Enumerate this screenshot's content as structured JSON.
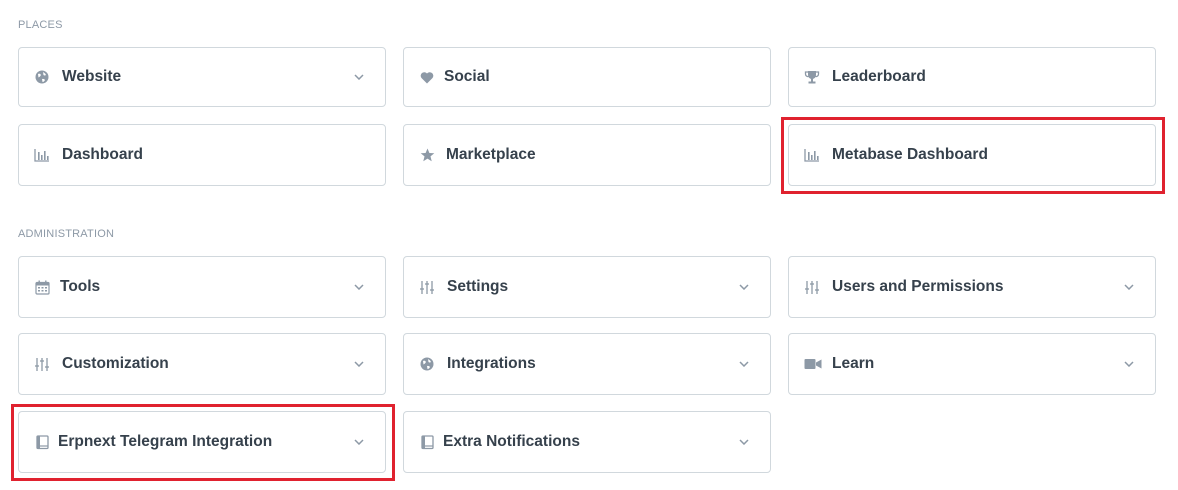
{
  "places": {
    "heading": "PLACES",
    "cards": [
      {
        "label": "Website",
        "icon": "globe-icon",
        "has_dropdown": true
      },
      {
        "label": "Social",
        "icon": "heart-icon",
        "has_dropdown": false
      },
      {
        "label": "Leaderboard",
        "icon": "trophy-icon",
        "has_dropdown": false
      },
      {
        "label": "Dashboard",
        "icon": "bar-chart-icon",
        "has_dropdown": false
      },
      {
        "label": "Marketplace",
        "icon": "star-icon",
        "has_dropdown": false
      },
      {
        "label": "Metabase Dashboard",
        "icon": "bar-chart-icon",
        "has_dropdown": false,
        "highlighted": true
      }
    ]
  },
  "administration": {
    "heading": "ADMINISTRATION",
    "cards": [
      {
        "label": "Tools",
        "icon": "calendar-icon",
        "has_dropdown": true
      },
      {
        "label": "Settings",
        "icon": "sliders-icon",
        "has_dropdown": true
      },
      {
        "label": "Users and Permissions",
        "icon": "sliders-icon",
        "has_dropdown": true
      },
      {
        "label": "Customization",
        "icon": "sliders-icon",
        "has_dropdown": true
      },
      {
        "label": "Integrations",
        "icon": "globe-icon",
        "has_dropdown": true
      },
      {
        "label": "Learn",
        "icon": "video-camera-icon",
        "has_dropdown": true
      },
      {
        "label": "Erpnext Telegram Integration",
        "icon": "book-icon",
        "has_dropdown": true,
        "highlighted": true
      },
      {
        "label": "Extra Notifications",
        "icon": "book-icon",
        "has_dropdown": true
      }
    ]
  },
  "colors": {
    "icon": "#8d99a6",
    "text": "#36414c",
    "border": "#d1d8dd",
    "highlight": "#e0222f"
  }
}
